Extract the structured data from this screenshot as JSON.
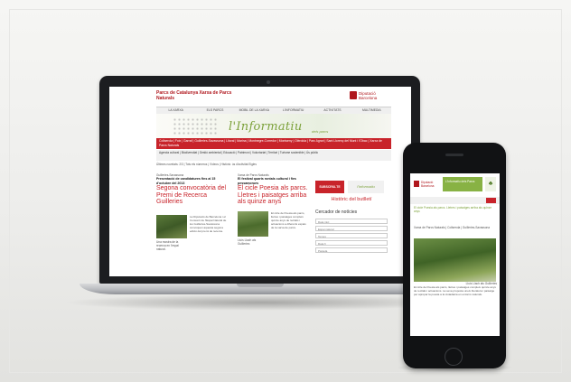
{
  "laptop": {
    "site_title": "Parcs de Catalunya Xarxa de Parcs Naturals",
    "brand": "Diputació Barcelona",
    "nav": [
      "LA XARXA",
      "ELS PARCS",
      "MOBIL DE LA XARXA",
      "L'INFORMATIU",
      "ACTIVITATS",
      "MULTIMEDIA"
    ],
    "banner_title": "l'Informatiu",
    "banner_sub": "dels parcs",
    "red_tags": "Collserola | Foix | Garraf | Guilleries-Savassona | Litoral | Marina | Montnegre-Corredor | Montseny | Olèrdola | Parc Agrari | Sant Llorenç del Munt i l'Obac | Xarxa de Parcs Naturals",
    "sub_tags": "Agenda cultural | Biodiversitat | Gestió ambiental | Educació | Patrimoni | Voluntariat | Territori | Turisme sostenible | Ús públic",
    "filter_text": "Últimes novetats: 2/3 | Tots els números | Vídeos | Històric: ús d'activitat Eigles",
    "col1_section": "Guilleries-Savassona",
    "col1_bold": "Presentació de candidatures fins al 15 d'octubre del 2013",
    "col1_headline": "Segona convocatòria del Premi de Recerca Guilleries",
    "col1_text": "La Diputació de Barcelona i el Consorci de l'Espai Natural de les Guilleries-Savassona convoquen aquesta segona edició del premi de recerca.",
    "col1_caption": "Una mostra de la recerca en l'espai natural.",
    "col2_section": "Xarxa de Parcs Naturals",
    "col2_bold": "El festival quarts rontals cultural i fies pessamorues",
    "col2_headline": "El cicle Poesia als parcs. Lletres i paisatges arriba als quinze anys",
    "col2_text": "El cicle de Poesia als parcs, lletres i paisatges compleix quinze anys de recitals i actuacions a diferents espais de la xarxa de parcs.",
    "col2_caption": "Lluís Llach als Guilleries",
    "subscribe": "SUBSCRIU-TE",
    "subscribe_logo": "l'Informatiu",
    "history_link": "Històric del butlletí",
    "search_title": "Cercador de notícies",
    "search_fields": [
      "Data inici",
      "Espai natural",
      "Temes",
      "Data fi",
      "Paraula"
    ]
  },
  "phone": {
    "brand": "Diputació Barcelona",
    "green_title": "L'Informatiu dels Parcs",
    "tree_icon": "tree-icon",
    "headline": "El cicle Poesia als parcs. Lletres i paisatges arriba als quinze anys",
    "tags": "Xarxa de Parcs Naturals | Collserola | Guilleries-Savassona",
    "photo_caption": "Lluís Llach als Guilleries",
    "body": "El cicle de Poesia als parcs, lletres i paisatges compleix quinze anys de recitals i actuacions. La seva proposta uneix literatura i paisatge per apropar la poesia a la ciutadania en entorns naturals."
  },
  "colors": {
    "red": "#c8232a",
    "green": "#88b244",
    "dark": "#1c1d20"
  }
}
